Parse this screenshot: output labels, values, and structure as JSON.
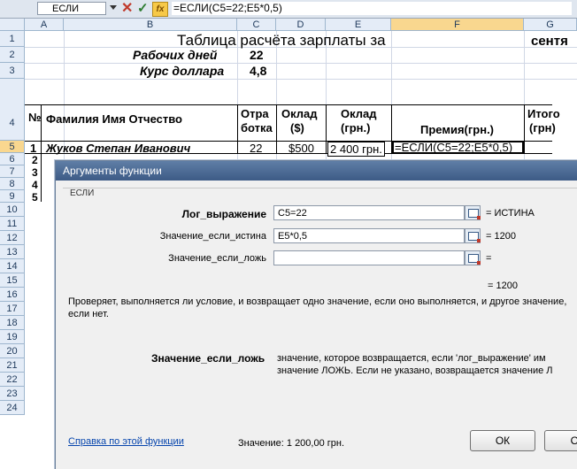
{
  "formula_bar": {
    "name_box": "ЕСЛИ",
    "formula": "=ЕСЛИ(C5=22;E5*0,5)"
  },
  "columns": [
    "A",
    "B",
    "C",
    "D",
    "E",
    "F",
    "G"
  ],
  "rows": [
    "1",
    "2",
    "3",
    "4",
    "5",
    "6",
    "7",
    "8",
    "9",
    "10",
    "11",
    "12",
    "13",
    "14",
    "15",
    "16",
    "17",
    "18",
    "19",
    "20",
    "21",
    "22",
    "23",
    "24"
  ],
  "sheet": {
    "title": "Таблица расчёта зарплаты за",
    "title_month": "сентя",
    "workdays_label": "Рабочих дней",
    "workdays_value": "22",
    "rate_label": "Курс доллара",
    "rate_value": "4,8",
    "headers": {
      "num": "№",
      "name": "Фамилия Имя Отчество",
      "worked_line1": "Отра",
      "worked_line2": "ботка",
      "salary_usd_line1": "Оклад",
      "salary_usd_line2": "($)",
      "salary_grn_line1": "Оклад",
      "salary_grn_line2": "(грн.)",
      "bonus": "Премия(грн.)",
      "total_line1": "Итого",
      "total_line2": "(грн)"
    },
    "row5": {
      "num": "1",
      "name": "Жуков Степан Иванович",
      "worked": "22",
      "salary_usd": "$500",
      "salary_grn": "2 400 грн.",
      "bonus_formula": "=ЕСЛИ(C5=22;E5*0,5)"
    },
    "visible_nums": [
      "2",
      "3",
      "4",
      "5"
    ]
  },
  "dialog": {
    "title": "Аргументы функции",
    "function_name": "ЕСЛИ",
    "args": [
      {
        "label": "Лог_выражение",
        "value": "C5=22",
        "result": "= ИСТИНА",
        "bold": true
      },
      {
        "label": "Значение_если_истина",
        "value": "E5*0,5",
        "result": "= 1200",
        "bold": false
      },
      {
        "label": "Значение_если_ложь",
        "value": "",
        "result": "=",
        "bold": false
      }
    ],
    "overall_result": "= 1200",
    "description": "Проверяет, выполняется ли условие, и возвращает одно значение, если оно выполняется, и другое значение, если нет.",
    "arg_help_label": "Значение_если_ложь",
    "arg_help_text_1": "значение, которое возвращается, если 'лог_выражение' им",
    "arg_help_text_2": "значение ЛОЖЬ. Если не указано, возвращается значение Л",
    "help_link": "Справка по этой функции",
    "value_line": "Значение: 1 200,00 грн.",
    "ok_label": "ОК",
    "cancel_label": "От"
  }
}
